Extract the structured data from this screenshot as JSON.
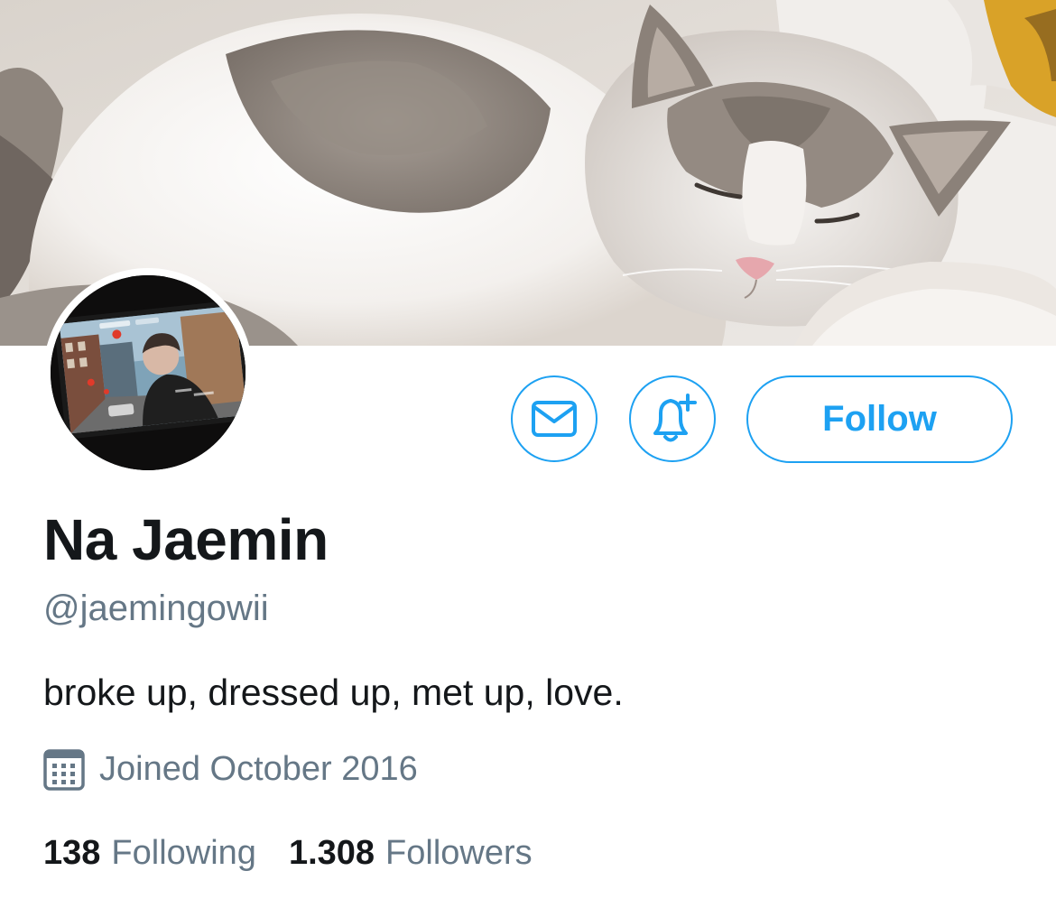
{
  "profile": {
    "display_name": "Na Jaemin",
    "handle": "@jaemingowii",
    "bio": "broke up, dressed up, met up, love.",
    "joined": "Joined October 2016",
    "following_count": "138",
    "following_label": "Following",
    "followers_count": "1.308",
    "followers_label": "Followers"
  },
  "actions": {
    "follow_label": "Follow",
    "message_icon": "envelope-icon",
    "notify_icon": "bell-plus-icon"
  },
  "icons": {
    "joined": "calendar-icon"
  },
  "colors": {
    "accent": "#1da1f2",
    "primary_text": "#14171a",
    "secondary_text": "#657786",
    "background": "#ffffff"
  }
}
